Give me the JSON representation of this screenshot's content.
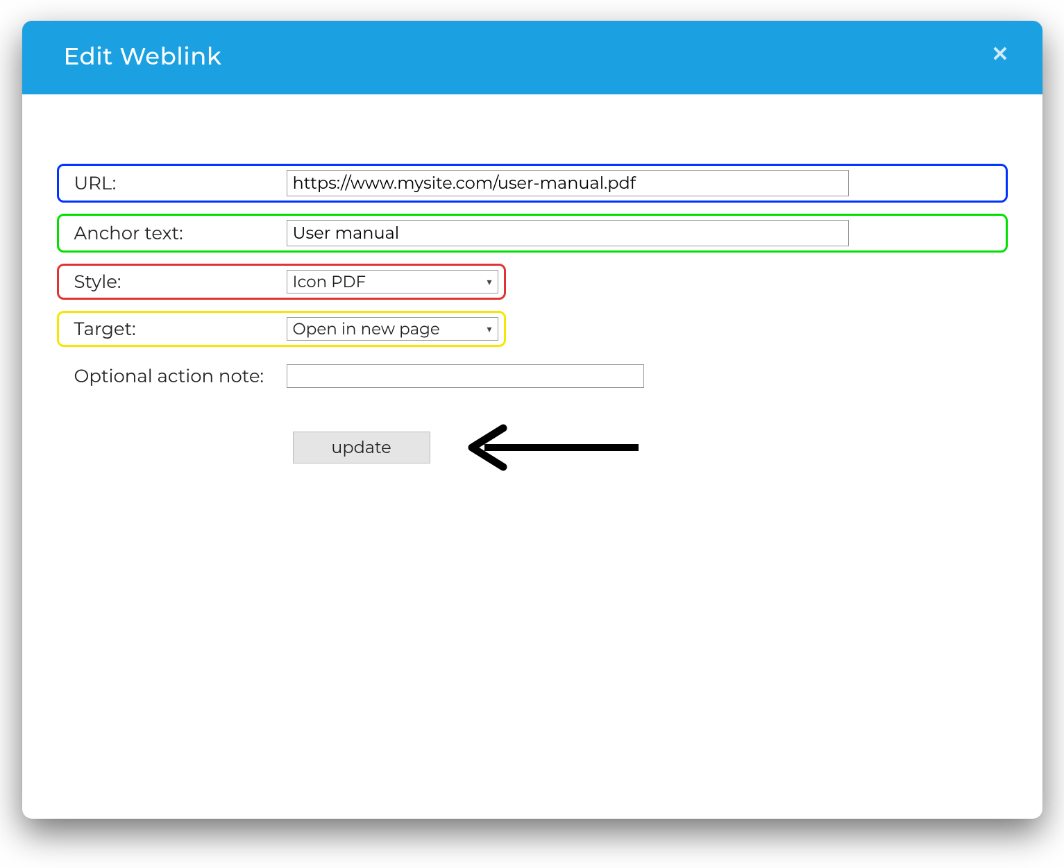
{
  "modal": {
    "title": "Edit Weblink"
  },
  "fields": {
    "url": {
      "label": "URL:",
      "value": "https://www.mysite.com/user-manual.pdf"
    },
    "anchor": {
      "label": "Anchor text:",
      "value": "User manual"
    },
    "style": {
      "label": "Style:",
      "value": "Icon PDF"
    },
    "target": {
      "label": "Target:",
      "value": "Open in new page"
    },
    "note": {
      "label": "Optional action note:",
      "value": ""
    }
  },
  "buttons": {
    "update": "update"
  }
}
